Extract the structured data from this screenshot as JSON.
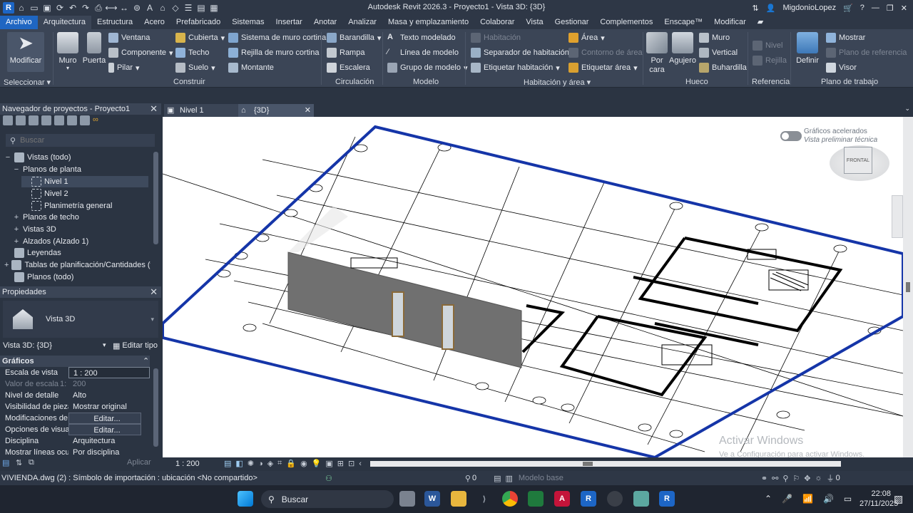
{
  "window": {
    "title": "Autodesk Revit 2026.3 - Proyecto1 - Vista 3D: {3D}",
    "user": "MigdonioLopez"
  },
  "menu_tabs": [
    "Archivo",
    "Arquitectura",
    "Estructura",
    "Acero",
    "Prefabricado",
    "Sistemas",
    "Insertar",
    "Anotar",
    "Analizar",
    "Masa y emplazamiento",
    "Colaborar",
    "Vista",
    "Gestionar",
    "Complementos",
    "Enscape™",
    "Modificar"
  ],
  "ribbon": {
    "select": {
      "modificar": "Modificar",
      "seleccionar": "Seleccionar"
    },
    "construir": {
      "label": "Construir",
      "muro": "Muro",
      "puerta": "Puerta",
      "ventana": "Ventana",
      "componente": "Componente",
      "pilar": "Pilar",
      "cubierta": "Cubierta",
      "techo": "Techo",
      "suelo": "Suelo",
      "sistema_muro_cortina": "Sistema de muro cortina",
      "rejilla_muro_cortina": "Rejilla de muro cortina",
      "montante": "Montante"
    },
    "circulacion": {
      "label": "Circulación",
      "barandilla": "Barandilla",
      "rampa": "Rampa",
      "escalera": "Escalera"
    },
    "modelo": {
      "label": "Modelo",
      "texto": "Texto modelado",
      "linea": "Línea de modelo",
      "grupo": "Grupo de modelo"
    },
    "habitacion": {
      "label": "Habitación y área",
      "habitacion": "Habitación",
      "separador": "Separador de habitación",
      "etiquetar_habitacion": "Etiquetar habitación",
      "area": "Área",
      "contorno_area": "Contorno de área",
      "etiquetar_area": "Etiquetar área"
    },
    "hueco": {
      "label": "Hueco",
      "por_cara": "Por cara",
      "agujero": "Agujero",
      "muro": "Muro",
      "vertical": "Vertical",
      "buhardilla": "Buhardilla"
    },
    "referencia": {
      "label": "Referencia",
      "nivel": "Nivel",
      "rejilla": "Rejilla"
    },
    "plano_trabajo": {
      "label": "Plano de trabajo",
      "definir": "Definir",
      "mostrar": "Mostrar",
      "plano_referencia": "Plano de referencia",
      "visor": "Visor"
    }
  },
  "browser": {
    "title": "Navegador de proyectos - Proyecto1",
    "search_placeholder": "Buscar",
    "items": [
      {
        "label": "Vistas (todo)"
      },
      {
        "label": "Planos de planta"
      },
      {
        "label": "Nivel 1"
      },
      {
        "label": "Nivel 2"
      },
      {
        "label": "Planimetría general"
      },
      {
        "label": "Planos de techo"
      },
      {
        "label": "Vistas 3D"
      },
      {
        "label": "Alzados (Alzado 1)"
      },
      {
        "label": "Leyendas"
      },
      {
        "label": "Tablas de planificación/Cantidades (tod"
      },
      {
        "label": "Planos (todo)"
      }
    ]
  },
  "properties": {
    "title": "Propiedades",
    "type_name": "Vista 3D",
    "instance": "Vista 3D: {3D}",
    "edit_type": "Editar tipo",
    "section": "Gráficos",
    "rows": [
      {
        "k": "Escala de vista",
        "v": "1 : 200"
      },
      {
        "k": "Valor de escala",
        "k2": "1:",
        "v": "200"
      },
      {
        "k": "Nivel de detalle",
        "v": "Alto"
      },
      {
        "k": "Visibilidad de piezas",
        "v": "Mostrar original"
      },
      {
        "k": "Modificaciones de ...",
        "v": "Editar..."
      },
      {
        "k": "Opciones de visuali...",
        "v": "Editar..."
      },
      {
        "k": "Disciplina",
        "v": "Arquitectura"
      },
      {
        "k": "Mostrar líneas ocul...",
        "v": "Por disciplina"
      }
    ],
    "apply": "Aplicar"
  },
  "view_tabs": [
    {
      "label": "Nivel 1"
    },
    {
      "label": "{3D}"
    }
  ],
  "canvas": {
    "graphics_toggle": "Gráficos acelerados",
    "graphics_sub": "Vista preliminar técnica",
    "viewcube": "FRONTAL",
    "watermark1": "Activar Windows",
    "watermark2": "Ve a Configuración para activar Windows."
  },
  "viewbar": {
    "scale": "1 : 200"
  },
  "status": {
    "text": "VIVIENDA.dwg (2) : Símbolo de importación : ubicación <No compartido>",
    "workset": "0",
    "model": "Modelo base",
    "filter": "0"
  },
  "taskbar": {
    "search": "Buscar",
    "time": "22:08",
    "date": "27/11/2025"
  }
}
